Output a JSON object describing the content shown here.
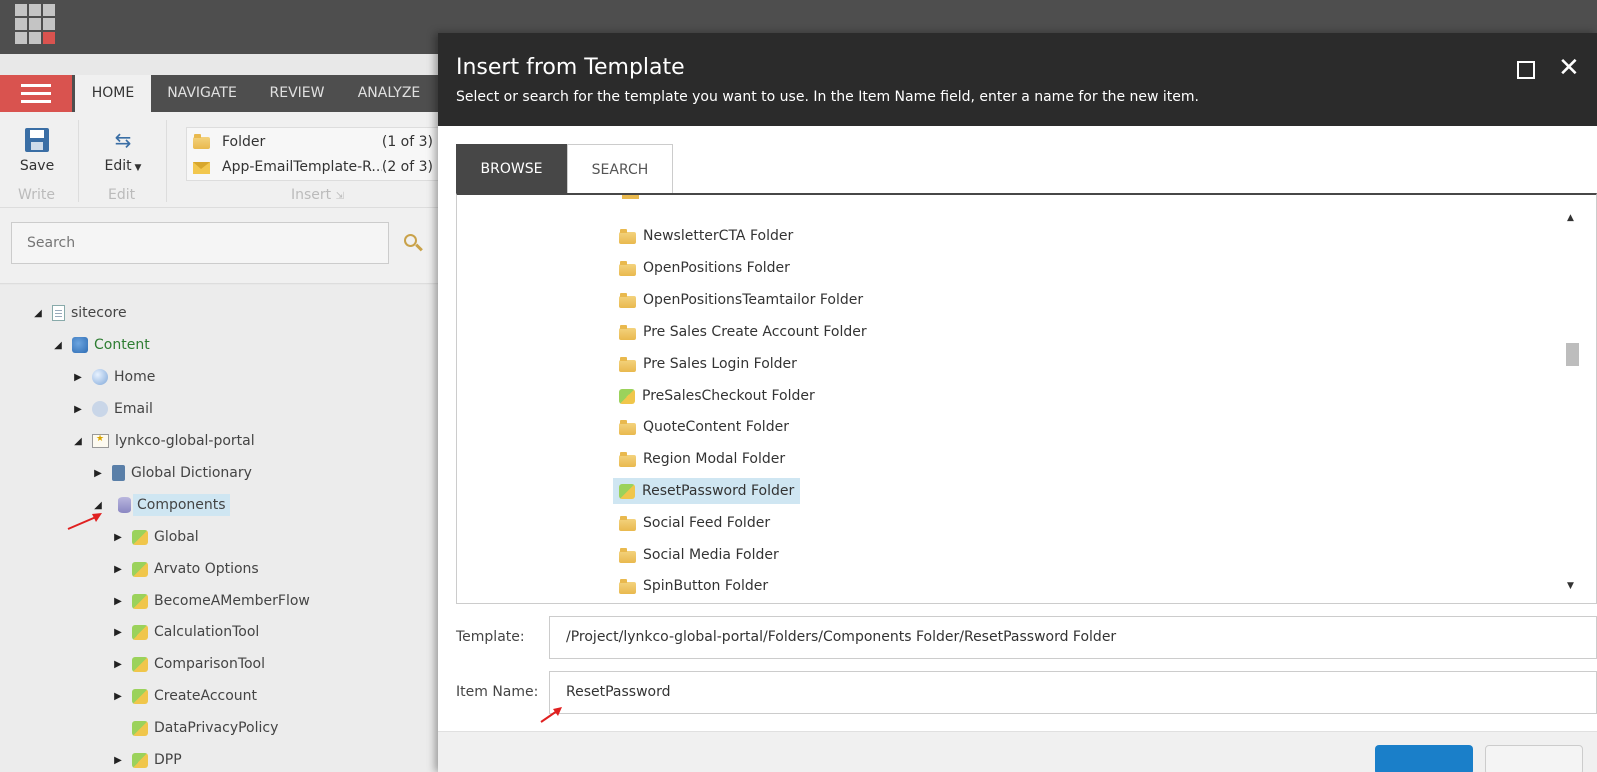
{
  "ribbon": {
    "tabs": [
      "HOME",
      "NAVIGATE",
      "REVIEW",
      "ANALYZE"
    ],
    "save_label": "Save",
    "edit_label": "Edit",
    "write_group": "Write",
    "edit_group": "Edit",
    "insert_group": "Insert",
    "insert_options": [
      {
        "label": "Folder",
        "count": "(1 of 3)"
      },
      {
        "label": "App-EmailTemplate-R...",
        "count": "(2 of 3)"
      }
    ]
  },
  "search": {
    "placeholder": "Search"
  },
  "tree": {
    "items": [
      {
        "label": "sitecore",
        "icon": "page-icon"
      },
      {
        "label": "Content",
        "icon": "content-icon"
      },
      {
        "label": "Home",
        "icon": "globe-icon"
      },
      {
        "label": "Email",
        "icon": "email-icon"
      },
      {
        "label": "lynkco-global-portal",
        "icon": "site-icon"
      },
      {
        "label": "Global Dictionary",
        "icon": "book-icon"
      },
      {
        "label": "Components",
        "icon": "database-icon"
      },
      {
        "label": "Global",
        "icon": "folder-icon"
      },
      {
        "label": "Arvato Options",
        "icon": "folder-icon"
      },
      {
        "label": "BecomeAMemberFlow",
        "icon": "folder-icon"
      },
      {
        "label": "CalculationTool",
        "icon": "folder-icon"
      },
      {
        "label": "ComparisonTool",
        "icon": "folder-icon"
      },
      {
        "label": "CreateAccount",
        "icon": "folder-icon"
      },
      {
        "label": "DataPrivacyPolicy",
        "icon": "folder-icon"
      },
      {
        "label": "DPP",
        "icon": "folder-icon"
      }
    ]
  },
  "dialog": {
    "title": "Insert from Template",
    "subtitle": "Select or search for the template you want to use. In the Item Name field, enter a name for the new item.",
    "tabs": {
      "browse": "BROWSE",
      "search": "SEARCH"
    },
    "templates": [
      {
        "label": "NewsletterCTA Folder",
        "icon": "folder-icon"
      },
      {
        "label": "OpenPositions Folder",
        "icon": "folder-icon"
      },
      {
        "label": "OpenPositionsTeamtailor Folder",
        "icon": "folder-icon"
      },
      {
        "label": "Pre Sales Create Account Folder",
        "icon": "folder-icon"
      },
      {
        "label": "Pre Sales Login Folder",
        "icon": "folder-icon"
      },
      {
        "label": "PreSalesCheckout Folder",
        "icon": "colored-folder-icon"
      },
      {
        "label": "QuoteContent Folder",
        "icon": "folder-icon"
      },
      {
        "label": "Region Modal Folder",
        "icon": "folder-icon"
      },
      {
        "label": "ResetPassword Folder",
        "icon": "colored-folder-icon"
      },
      {
        "label": "Social Feed Folder",
        "icon": "folder-icon"
      },
      {
        "label": "Social Media Folder",
        "icon": "folder-icon"
      },
      {
        "label": "SpinButton Folder",
        "icon": "folder-icon"
      }
    ],
    "template_label": "Template:",
    "template_value": "/Project/lynkco-global-portal/Folders/Components Folder/ResetPassword Folder",
    "item_name_label": "Item Name:",
    "item_name_value": "ResetPassword"
  },
  "colors": {
    "accent": "#d9534f",
    "primary_button": "#1a7fc9",
    "dialog_header": "#2b2b2b",
    "selection": "#cfe6f2"
  }
}
